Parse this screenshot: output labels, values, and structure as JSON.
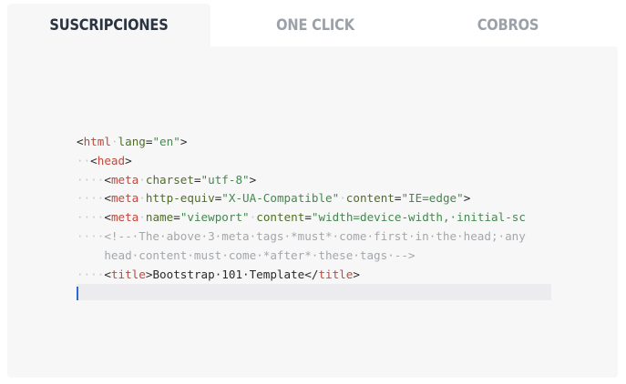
{
  "tabs": [
    {
      "label": "SUSCRIPCIONES",
      "active": true
    },
    {
      "label": "ONE CLICK",
      "active": false
    },
    {
      "label": "COBROS",
      "active": false
    }
  ],
  "editor": {
    "line1": {
      "open": "<",
      "tag": "html",
      "attr": "lang",
      "eq": "=",
      "val": "\"en\"",
      "close": ">"
    },
    "line2": {
      "indent": "··",
      "open": "<",
      "tag": "head",
      "close": ">"
    },
    "line3": {
      "indent": "····",
      "open": "<",
      "tag": "meta",
      "attr": "charset",
      "eq": "=",
      "val": "\"utf-8\"",
      "close": ">"
    },
    "line4": {
      "indent": "····",
      "open": "<",
      "tag": "meta",
      "attr1": "http-equiv",
      "eq1": "=",
      "val1": "\"X-UA-Compatible\"",
      "attr2": "content",
      "eq2": "=",
      "val2": "\"IE=edge\"",
      "close": ">"
    },
    "line5": {
      "indent": "····",
      "open": "<",
      "tag": "meta",
      "attr1": "name",
      "eq1": "=",
      "val1": "\"viewport\"",
      "attr2": "content",
      "eq2": "=",
      "val2": "\"width=device-width,·initial-sc"
    },
    "line6": {
      "indent": "····",
      "comment": "<!--·The·above·3·meta·tags·*must*·come·first·in·the·head;·any"
    },
    "line7": {
      "indent": "    ",
      "comment": "head·content·must·come·*after*·these·tags·-->"
    },
    "line8": {
      "indent": "····",
      "open": "<",
      "tag": "title",
      "close": ">",
      "text": "Bootstrap·101·Template",
      "end_open": "</",
      "end_tag": "title",
      "end_close": ">"
    }
  },
  "colors": {
    "panel_bg": "#f7f7f8",
    "tab_active": "#2b3441",
    "tab_inactive": "#9ba1a8",
    "tag": "#c2483c",
    "attr": "#4e6f23",
    "string": "#44884f",
    "comment": "#a4a7ab",
    "caret": "#2b6bd6"
  }
}
